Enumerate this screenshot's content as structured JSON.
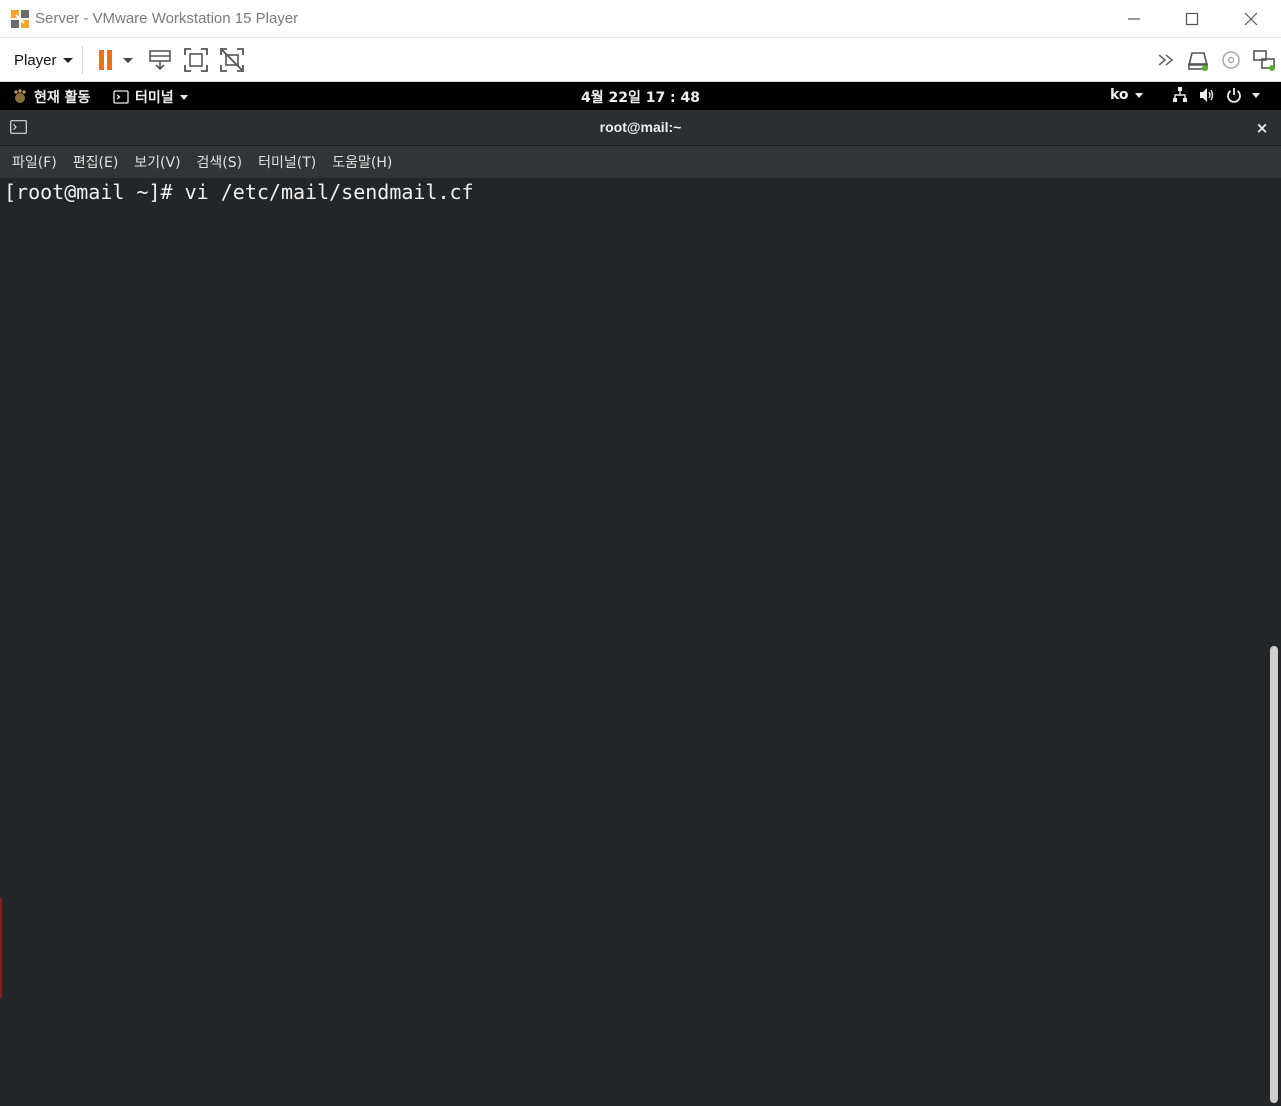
{
  "window": {
    "title": "Server - VMware Workstation 15 Player"
  },
  "toolbar": {
    "player_label": "Player"
  },
  "gnome": {
    "activities_label": "현재 활동",
    "app_menu_label": "터미널",
    "clock": "4월 22일  17 : 48",
    "language": "ko"
  },
  "terminal": {
    "title": "root@mail:~",
    "close_label": "×",
    "menu": [
      "파일(F)",
      "편집(E)",
      "보기(V)",
      "검색(S)",
      "터미널(T)",
      "도움말(H)"
    ],
    "line_1": "[root@mail ~]# vi /etc/mail/sendmail.cf"
  },
  "colors": {
    "pause_accent": "#f26b21",
    "terminal_bg": "#232629",
    "gnome_bar_bg": "#000000"
  }
}
